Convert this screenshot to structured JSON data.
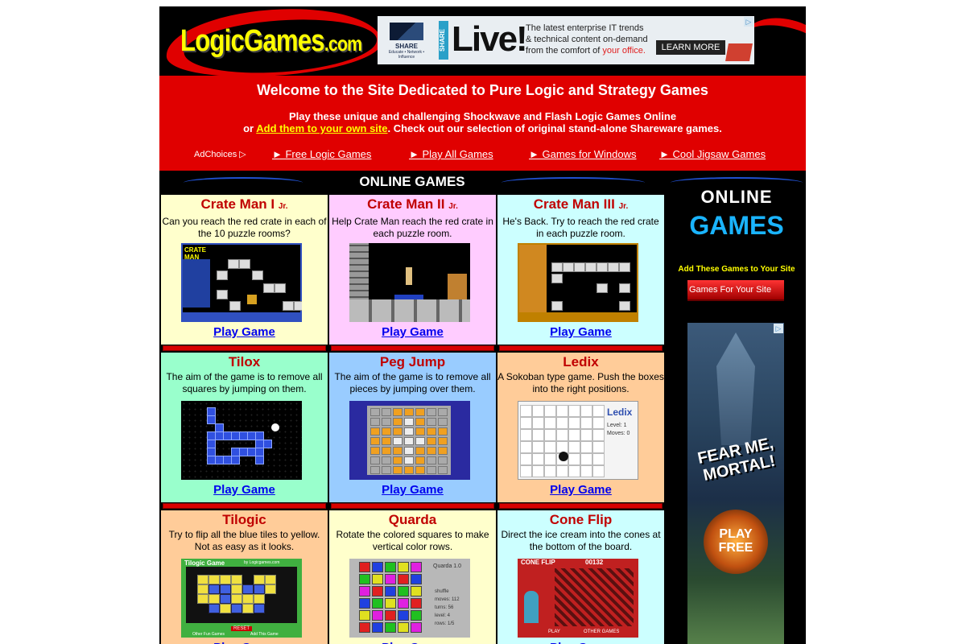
{
  "header": {
    "logo_main": "LogicGames",
    "logo_suffix": ".com",
    "ad": {
      "brand": "SHARE",
      "brand_tagline": "Educate • Network • Influence",
      "vertical_tag": "SHARE",
      "headline": "Live!",
      "copy_line1": "The latest enterprise IT trends",
      "copy_line2": "& technical content on-demand",
      "copy_line3_prefix": "from the comfort of ",
      "copy_line3_highlight": "your office.",
      "cta": "LEARN MORE",
      "adchoice_icon": "▷"
    }
  },
  "welcome": {
    "title": "Welcome to the Site Dedicated to Pure Logic and Strategy Games",
    "line1": "Play these unique and challenging Shockwave and Flash Logic Games Online",
    "line2_prefix": "or ",
    "line2_link": "Add them to your own site",
    "line2_suffix": ". Check out our selection of original stand-alone Shareware games."
  },
  "nav": {
    "adchoices": "AdChoices ▷",
    "items": [
      "► Free Logic Games",
      "► Play All Games",
      "► Games for Windows",
      "► Cool Jigsaw Games"
    ]
  },
  "main": {
    "section_title": "ONLINE GAMES",
    "play_label": "Play Game",
    "games": [
      {
        "title": "Crate Man I",
        "suffix": "Jr.",
        "desc": "Can you reach the red crate in each of the 10 puzzle rooms?",
        "bg": "#ffffcc"
      },
      {
        "title": "Crate Man II",
        "suffix": "Jr.",
        "desc": "Help Crate Man reach the red crate in each puzzle room.",
        "bg": "#ffccff"
      },
      {
        "title": "Crate Man III",
        "suffix": "Jr.",
        "desc": "He's Back. Try to reach the red crate in each puzzle room.",
        "bg": "#ccffff"
      },
      {
        "title": "Tilox",
        "suffix": "",
        "desc": "The aim of the game is to remove all squares by jumping on them.",
        "bg": "#99ffcc"
      },
      {
        "title": "Peg Jump",
        "suffix": "",
        "desc": "The aim of the game is to remove all pieces by jumping over them.",
        "bg": "#99ccff"
      },
      {
        "title": "Ledix",
        "suffix": "",
        "desc": "A Sokoban type game. Push the boxes into the right positions.",
        "bg": "#ffcc99"
      },
      {
        "title": "Tilogic",
        "suffix": "",
        "desc": "Try to flip all the blue tiles to yellow. Not as easy as it looks.",
        "bg": "#ffcc99"
      },
      {
        "title": "Quarda",
        "suffix": "",
        "desc": "Rotate the colored squares to make vertical color rows.",
        "bg": "#ffffcc"
      },
      {
        "title": "Cone Flip",
        "suffix": "",
        "desc": "Direct the ice cream into the cones at the bottom of the board.",
        "bg": "#ccffff"
      }
    ],
    "thumbs": {
      "crate1_title": "CRATE MAN",
      "ledix_title": "Ledix",
      "ledix_level": "Level: 1",
      "ledix_moves": "Moves: 0",
      "tilogic_title": "Tilogic Game",
      "tilogic_by": "by Logicgames.com",
      "tilogic_reset": "RESET",
      "tilogic_other": "Other Fun Games",
      "tilogic_add": "Add This Game",
      "quarda_title": "Quarda 1.0",
      "quarda_stats": [
        "shuffle",
        "moves: 112",
        "turns: 56",
        "level: 4",
        "rows: 1/5"
      ],
      "cone_title": "CONE FLIP",
      "cone_score": "00132",
      "cone_play": "PLAY",
      "cone_other": "OTHER GAMES"
    }
  },
  "sidebar": {
    "online": "ONLINE",
    "games": "GAMES",
    "add": "Add These Games to Your Site",
    "games_for_site": "Games For Your Site",
    "ad": {
      "headline": "FEAR ME, MORTAL!",
      "cta": "PLAY FREE",
      "adchoice_icon": "▷"
    }
  },
  "colors": {
    "accent_red": "#e00000",
    "logo_yellow": "#ffff00",
    "link_blue": "#0000ee",
    "title_red": "#c00000",
    "games_blue": "#1ab4ff"
  }
}
